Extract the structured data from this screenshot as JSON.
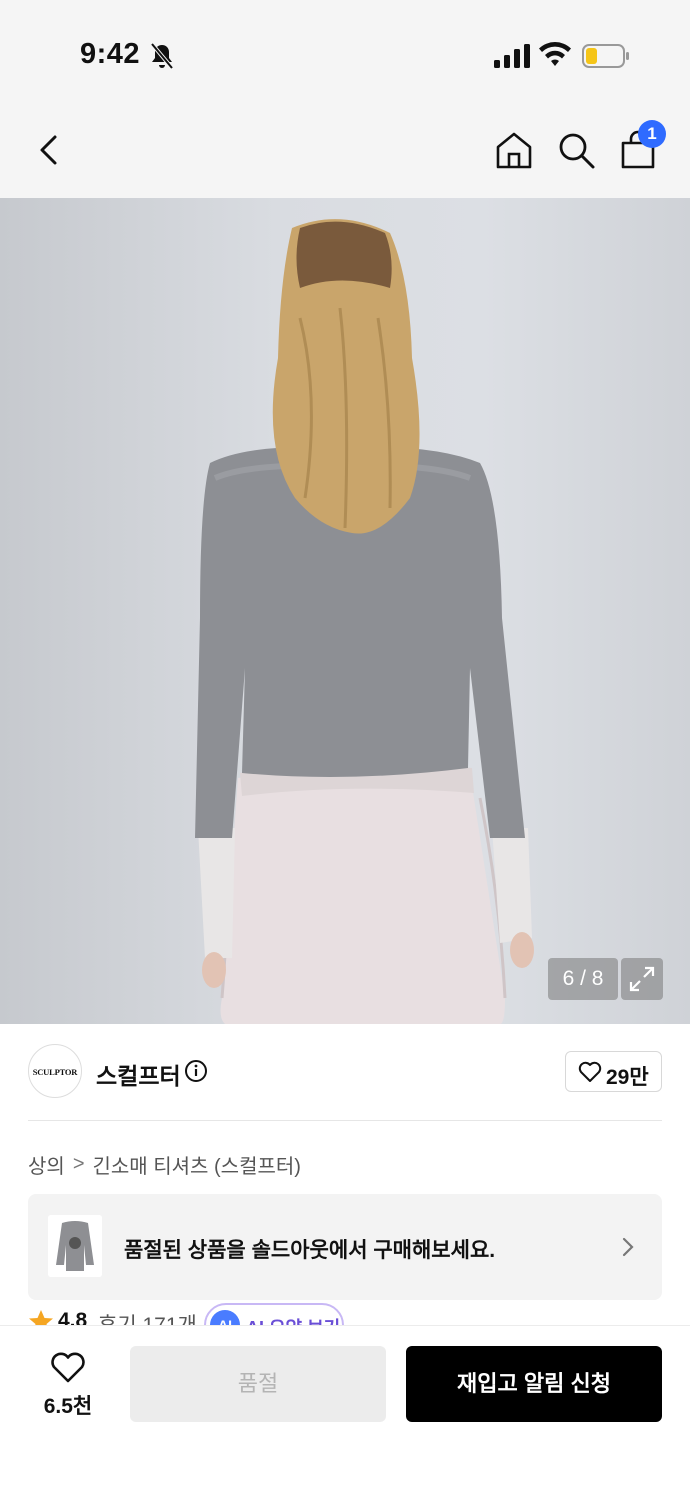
{
  "status_bar": {
    "time": "9:42",
    "icons": [
      "bell-off-icon",
      "signal-icon",
      "wifi-icon",
      "battery-icon"
    ],
    "battery_color": "#f5c518"
  },
  "nav": {
    "icons": [
      "back-icon",
      "home-icon",
      "search-icon",
      "cart-icon"
    ],
    "cart_badge": "1",
    "badge_color": "#2f6bff"
  },
  "product_image": {
    "counter": "6 / 8",
    "expand_icon": "expand-icon"
  },
  "brand": {
    "logo_text": "SCULPTOR",
    "name": "스컬프터",
    "info_icon": "info-icon",
    "likes": "29만"
  },
  "breadcrumb": {
    "items": [
      "상의",
      "긴소매 티셔츠 (스컬프터)"
    ],
    "separator": ">"
  },
  "soldout_banner": {
    "text": "품절된 상품을 솔드아웃에서 구매해보세요."
  },
  "rating": {
    "score": "4.8",
    "reviews": "후기 171개",
    "ai_badge": "AI",
    "ai_label": "AI 요약 보기"
  },
  "bottom_bar": {
    "wish_count": "6.5천",
    "soldout_label": "품절",
    "restock_label": "재입고 알림 신청"
  }
}
